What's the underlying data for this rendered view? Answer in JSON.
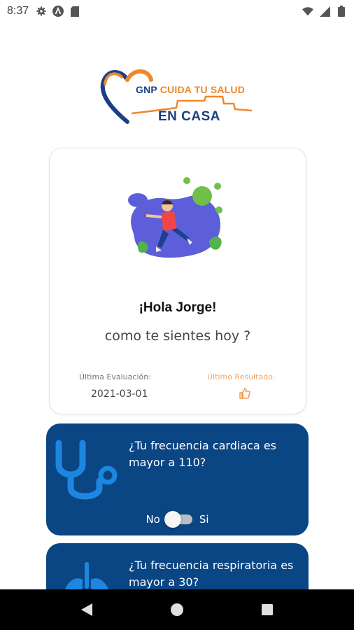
{
  "status_bar": {
    "time": "8:37",
    "left_icons": [
      "gear-icon",
      "a-circle-icon",
      "sd-card-icon"
    ],
    "right_icons": [
      "wifi-icon",
      "signal-icon",
      "battery-icon"
    ]
  },
  "logo": {
    "brand": "GNP",
    "tagline": "CUIDA TU SALUD",
    "subtitle": "EN CASA"
  },
  "greeting": {
    "title": "¡Hola Jorge!",
    "subtitle": "como te sientes hoy ?",
    "last_evaluation_label": "Última Evaluación:",
    "last_evaluation_date": "2021-03-01",
    "last_result_label": "Último Resultado:",
    "last_result_icon": "thumbs-up-icon"
  },
  "questions": [
    {
      "icon": "stethoscope-icon",
      "text": "¿Tu frecuencia cardiaca es mayor a 110?",
      "no_label": "No",
      "yes_label": "Si",
      "answer": "No"
    },
    {
      "icon": "lungs-icon",
      "text": "¿Tu frecuencia respiratoria es mayor a 30?"
    }
  ],
  "colors": {
    "card_blue": "#0a4584",
    "icon_blue": "#1d86e0",
    "brand_orange": "#f0882a",
    "brand_navy": "#1c3f86"
  },
  "nav_bar": [
    "back-icon",
    "home-icon",
    "recents-icon"
  ]
}
